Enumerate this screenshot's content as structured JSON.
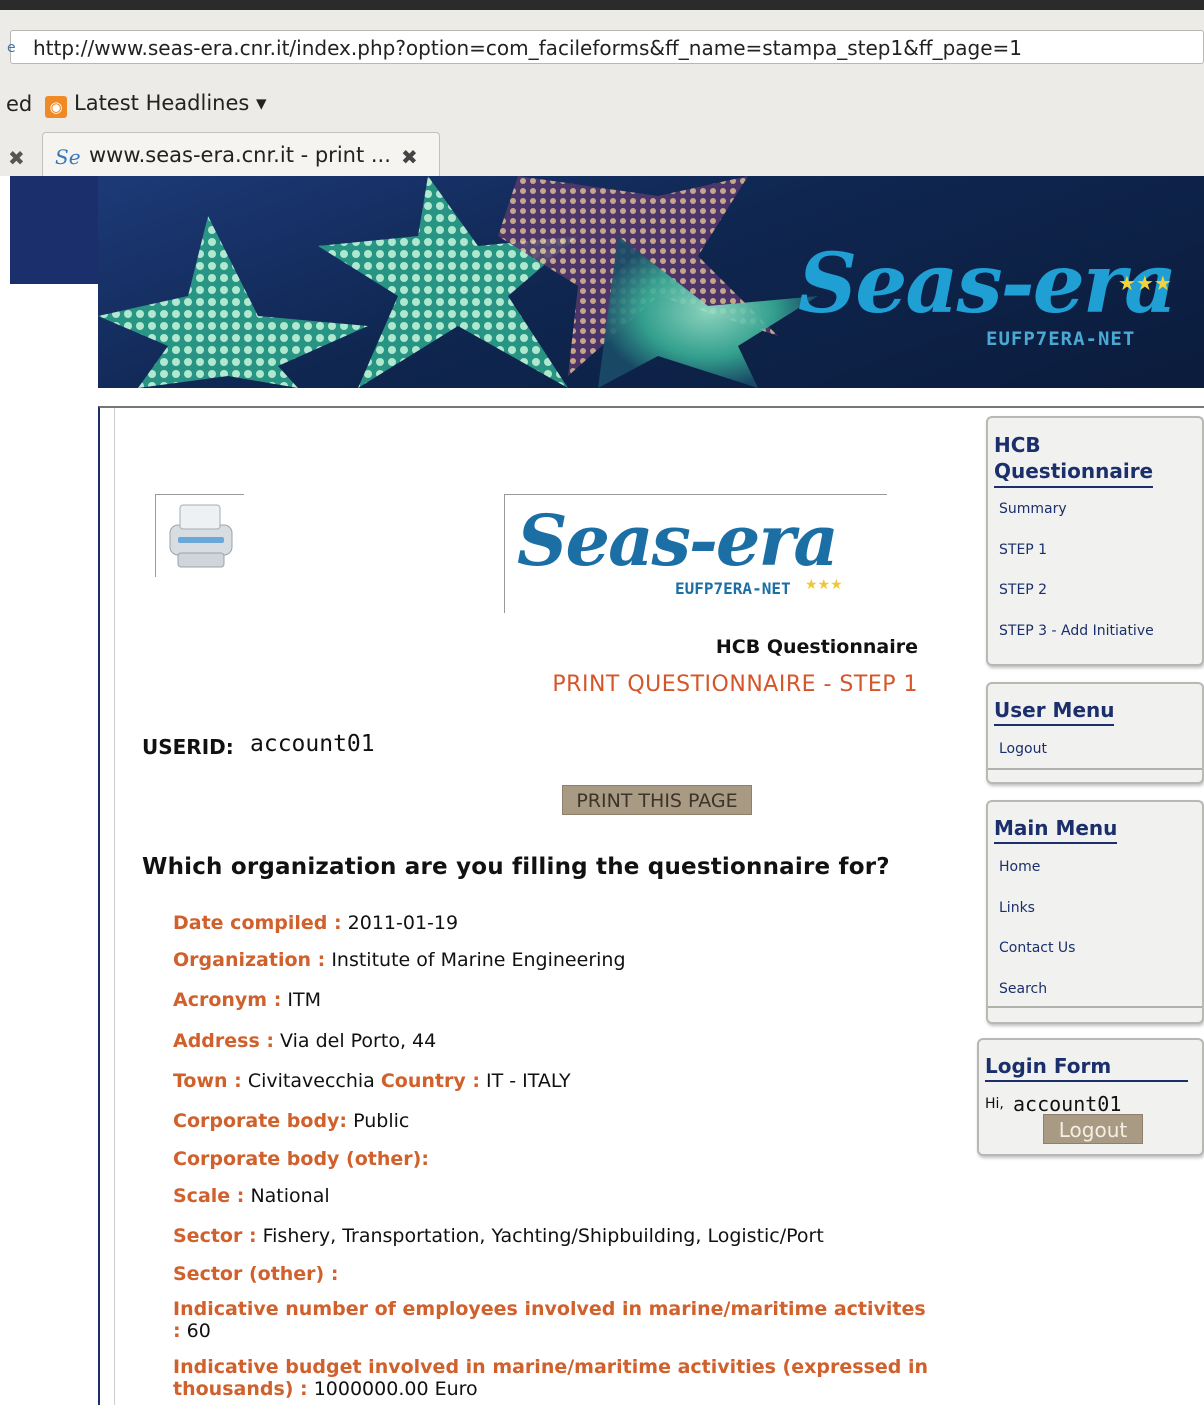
{
  "browser": {
    "url": "http://www.seas-era.cnr.it/index.php?option=com_facileforms&ff_name=stampa_step1&ff_page=1",
    "bookmark_partial": "ed",
    "bookmark_latest": "Latest Headlines ▾",
    "tab_title": "www.seas-era.cnr.it - print ..."
  },
  "banner": {
    "logo": "Seas-era",
    "subtitle": "EUFP7ERA-NET",
    "stars": "★★★"
  },
  "page": {
    "logo": "Seas-era",
    "logo_sub": "EUFP7ERA-NET",
    "logo_stars": "★★★",
    "title": "HCB Questionnaire",
    "subtitle": "PRINT QUESTIONNAIRE - STEP 1",
    "userid_label": "USERID:",
    "userid_value": "account01",
    "print_button": "PRINT THIS PAGE",
    "section_question": "Which organization are you filling the questionnaire for?"
  },
  "fields": {
    "date_label": "Date compiled :",
    "date_value": "2011-01-19",
    "org_label": "Organization :",
    "org_value": "Institute of Marine Engineering",
    "acronym_label": "Acronym :",
    "acronym_value": "ITM",
    "address_label": "Address :",
    "address_value": "Via del Porto, 44",
    "town_label": "Town :",
    "town_value": "Civitavecchia",
    "country_label": "Country :",
    "country_value": "IT - ITALY",
    "corp_label": "Corporate body:",
    "corp_value": "Public",
    "corp_other_label": "Corporate body (other):",
    "scale_label": "Scale :",
    "scale_value": "National",
    "sector_label": "Sector :",
    "sector_value": "Fishery, Transportation, Yachting/Shipbuilding, Logistic/Port",
    "sector_other_label": "Sector (other) :",
    "employees_label": "Indicative number of employees involved in marine/maritime activites :",
    "employees_value": "60",
    "budget_label": "Indicative budget involved in marine/maritime activities (expressed in thousands) :",
    "budget_value": "1000000.00 Euro"
  },
  "sidebar": {
    "hcb": {
      "title_line1": "HCB",
      "title_line2": "Questionnaire",
      "items": [
        "Summary",
        "STEP 1",
        "STEP 2",
        "STEP 3 - Add Initiative"
      ]
    },
    "user_menu": {
      "title": "User Menu",
      "items": [
        "Logout"
      ]
    },
    "main_menu": {
      "title": "Main Menu",
      "items": [
        "Home",
        "Links",
        "Contact Us",
        "Search"
      ]
    },
    "login": {
      "title": "Login Form",
      "hi": "Hi,",
      "user": "account01",
      "logout": "Logout"
    }
  },
  "colors": {
    "accent_orange": "#d0602c",
    "menu_blue": "#1a2f6c",
    "button_tan": "#a99a84"
  }
}
